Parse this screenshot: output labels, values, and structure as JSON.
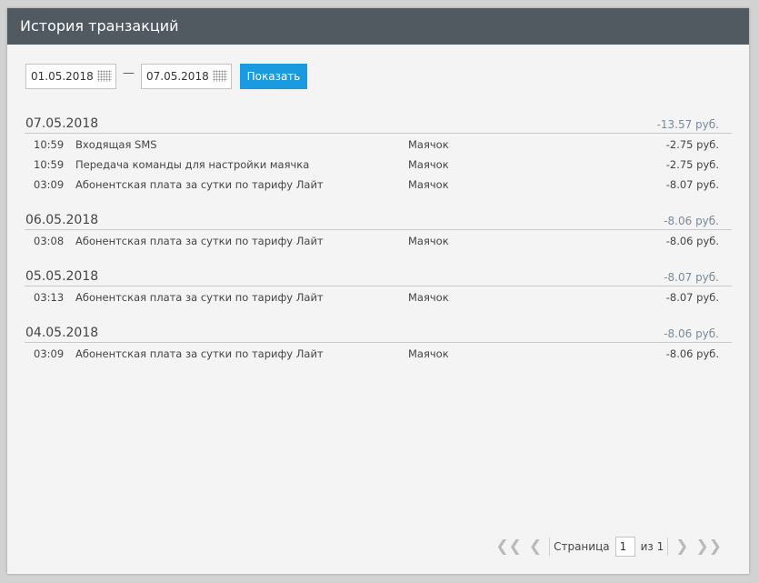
{
  "window": {
    "title": "История транзакций"
  },
  "filters": {
    "date_from": "01.05.2018",
    "separator": "—",
    "date_to": "07.05.2018",
    "show_label": "Показать"
  },
  "groups": [
    {
      "date": "07.05.2018",
      "total": "-13.57 руб.",
      "transactions": [
        {
          "time": "10:59",
          "description": "Входящая SMS",
          "object": "Маячок",
          "amount": "-2.75 руб."
        },
        {
          "time": "10:59",
          "description": "Передача команды для настройки маячка",
          "object": "Маячок",
          "amount": "-2.75 руб."
        },
        {
          "time": "03:09",
          "description": "Абонентская плата за сутки по тарифу Лайт",
          "object": "Маячок",
          "amount": "-8.07 руб."
        }
      ]
    },
    {
      "date": "06.05.2018",
      "total": "-8.06 руб.",
      "transactions": [
        {
          "time": "03:08",
          "description": "Абонентская плата за сутки по тарифу Лайт",
          "object": "Маячок",
          "amount": "-8.06 руб."
        }
      ]
    },
    {
      "date": "05.05.2018",
      "total": "-8.07 руб.",
      "transactions": [
        {
          "time": "03:13",
          "description": "Абонентская плата за сутки по тарифу Лайт",
          "object": "Маячок",
          "amount": "-8.07 руб."
        }
      ]
    },
    {
      "date": "04.05.2018",
      "total": "-8.06 руб.",
      "transactions": [
        {
          "time": "03:09",
          "description": "Абонентская плата за сутки по тарифу Лайт",
          "object": "Маячок",
          "amount": "-8.06 руб."
        }
      ]
    }
  ],
  "pager": {
    "first_icon": "double-chevron-left-icon",
    "prev_icon": "chevron-left-icon",
    "next_icon": "chevron-right-icon",
    "last_icon": "double-chevron-right-icon",
    "page_label": "Страница",
    "current_page": "1",
    "of_label": "из 1"
  },
  "colors": {
    "titlebar_bg": "#525a61",
    "accent_button": "#1a9be0",
    "total_text": "#7a8a99"
  }
}
